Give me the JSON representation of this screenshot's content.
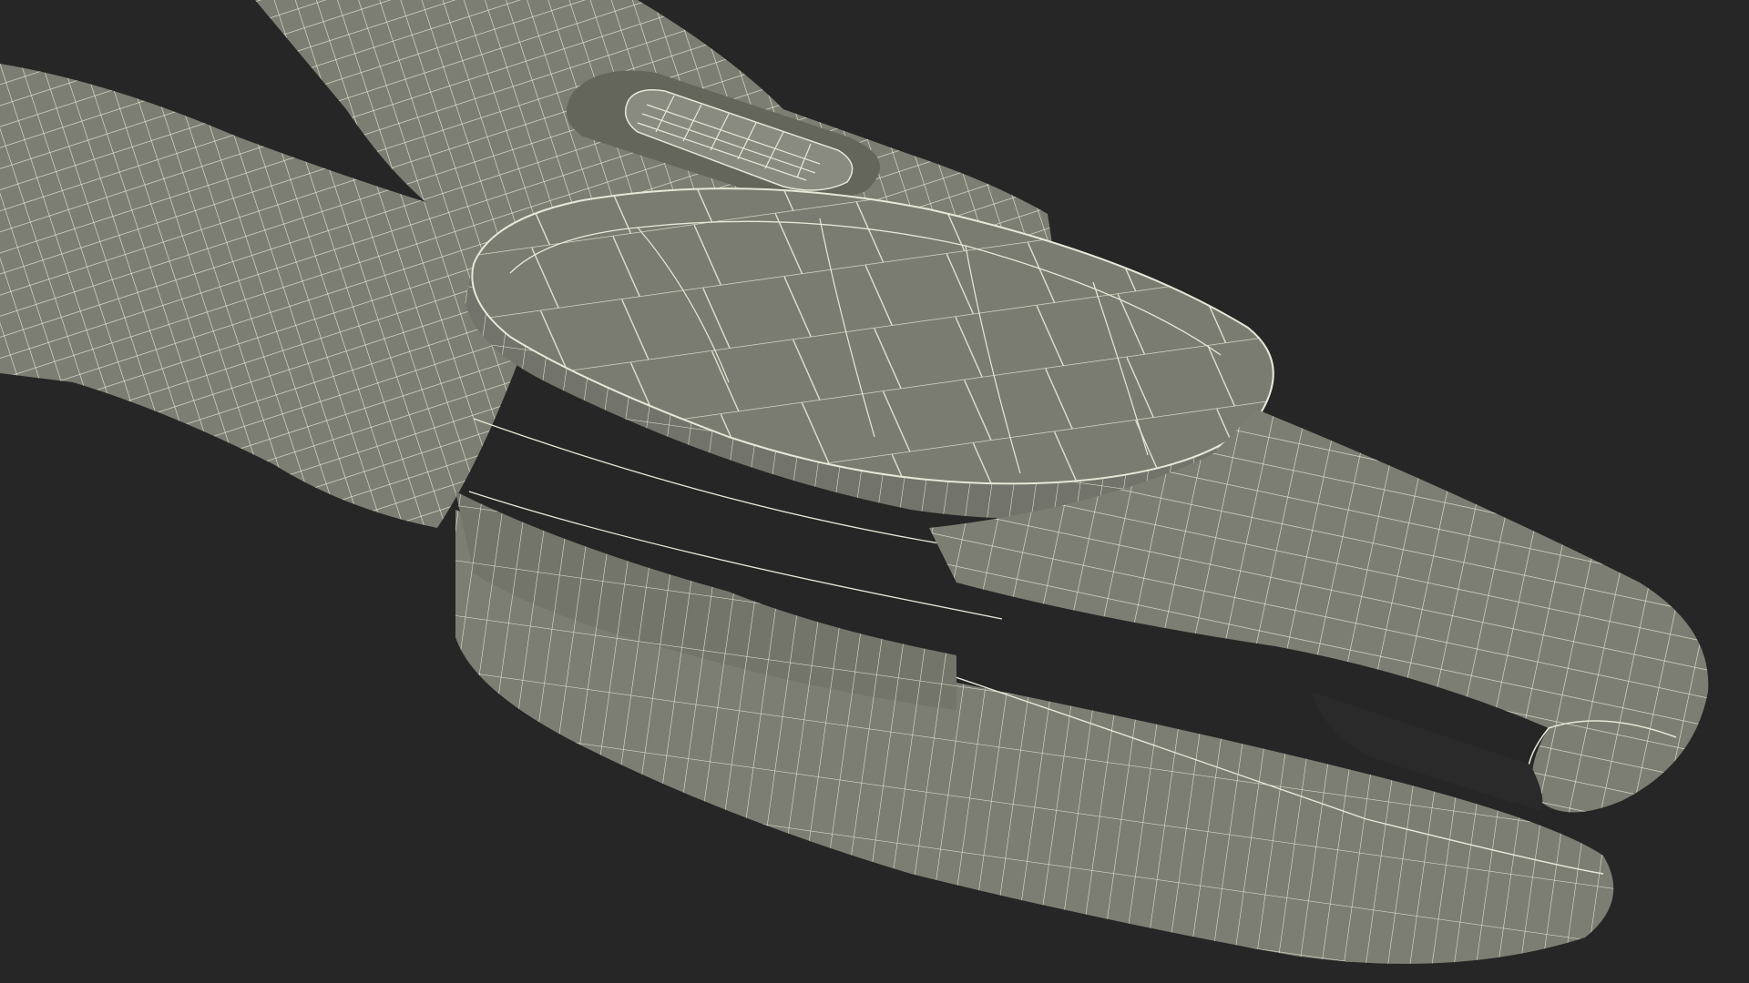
{
  "render": {
    "background": "#262626",
    "surface": "#7d7e73",
    "surface_light": "#8a8b80",
    "surface_dark": "#64655b",
    "wire": "#e6e8d8"
  },
  "icons": {
    "subject": "pliers-wireframe-icon"
  }
}
